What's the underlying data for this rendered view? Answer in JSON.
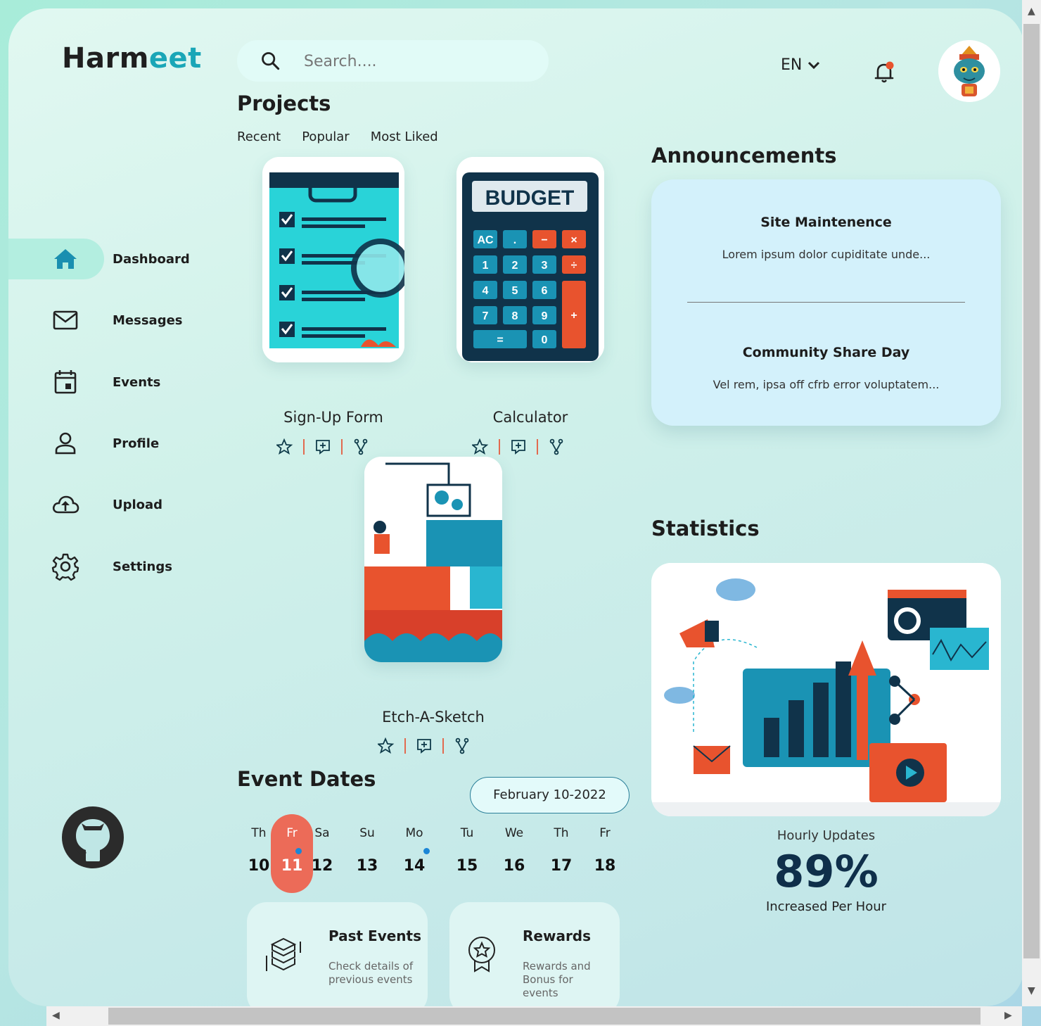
{
  "logo": {
    "part1": "Harm",
    "part2": "eet"
  },
  "search": {
    "placeholder": "Search...."
  },
  "header": {
    "language": "EN"
  },
  "colors": {
    "accent": "#1aa6b7",
    "highlight": "#ec6b58",
    "dot": "#1b86d6"
  },
  "sidebar": {
    "items": [
      {
        "label": "Dashboard",
        "icon": "home-icon"
      },
      {
        "label": "Messages",
        "icon": "mail-icon"
      },
      {
        "label": "Events",
        "icon": "calendar-icon"
      },
      {
        "label": "Profile",
        "icon": "user-icon"
      },
      {
        "label": "Upload",
        "icon": "cloud-upload-icon"
      },
      {
        "label": "Settings",
        "icon": "gear-icon"
      }
    ]
  },
  "projects": {
    "title": "Projects",
    "tabs": [
      "Recent",
      "Popular",
      "Most Liked"
    ],
    "cards": [
      {
        "title": "Sign-Up Form"
      },
      {
        "title": "Calculator",
        "image_text": "BUDGET"
      },
      {
        "title": "Etch-A-Sketch"
      }
    ]
  },
  "announcements": {
    "title": "Announcements",
    "items": [
      {
        "title": "Site Maintenence",
        "text": "Lorem ipsum dolor cupiditate unde..."
      },
      {
        "title": "Community Share Day",
        "text": "Vel rem, ipsa off cfrb error voluptatem..."
      }
    ]
  },
  "statistics": {
    "title": "Statistics",
    "caption": "Hourly Updates",
    "value": "89%",
    "subcaption": "Increased Per Hour"
  },
  "events": {
    "title": "Event Dates",
    "selected_range": "February 10-2022",
    "days": [
      {
        "name": "Th",
        "date": "10"
      },
      {
        "name": "Fr",
        "date": "11"
      },
      {
        "name": "Sa",
        "date": "12"
      },
      {
        "name": "Su",
        "date": "13"
      },
      {
        "name": "Mo",
        "date": "14"
      },
      {
        "name": "Tu",
        "date": "15"
      },
      {
        "name": "We",
        "date": "16"
      },
      {
        "name": "Th",
        "date": "17"
      },
      {
        "name": "Fr",
        "date": "18"
      }
    ]
  },
  "bottom_cards": [
    {
      "title": "Past Events",
      "text": "Check details of previous events"
    },
    {
      "title": "Rewards",
      "text": "Rewards and Bonus for events"
    }
  ]
}
